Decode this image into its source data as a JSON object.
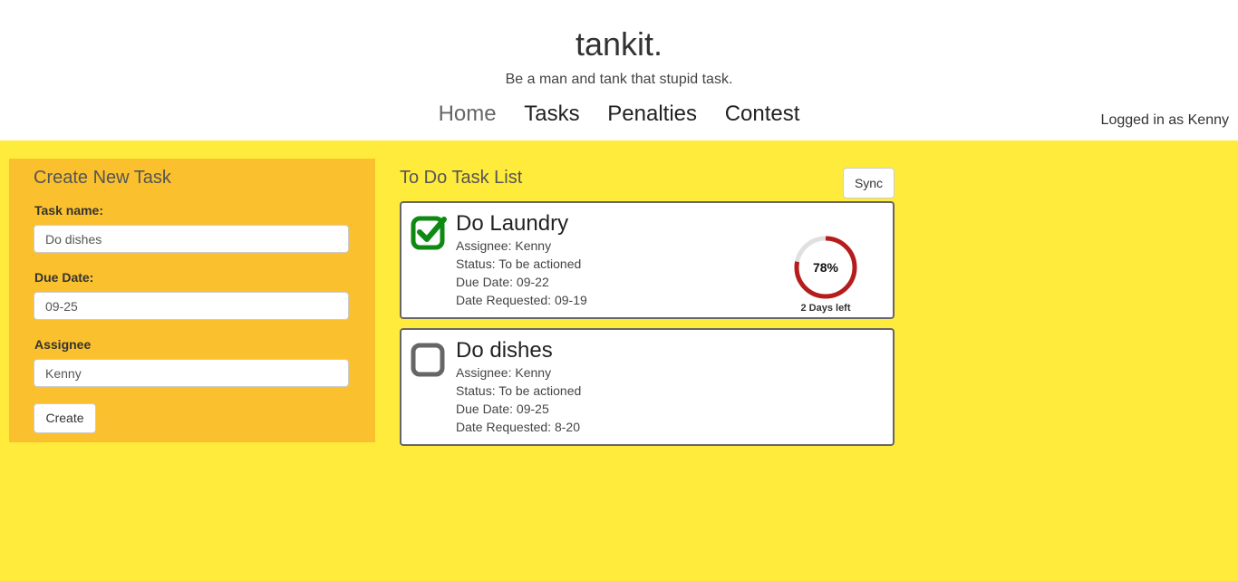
{
  "header": {
    "brand": "tankit.",
    "tagline": "Be a man and tank that stupid task.",
    "nav": [
      "Home",
      "Tasks",
      "Penalties",
      "Contest"
    ],
    "active_nav": "Home",
    "logged_in": "Logged in as Kenny"
  },
  "create": {
    "title": "Create New Task",
    "task_name_label": "Task name:",
    "task_name_value": "Do dishes",
    "due_date_label": "Due Date:",
    "due_date_value": "09-25",
    "assignee_label": "Assignee",
    "assignee_value": "Kenny",
    "create_button": "Create"
  },
  "list": {
    "title": "To Do Task List",
    "sync_button": "Sync",
    "tasks": [
      {
        "name": "Do Laundry",
        "checked": true,
        "assignee": "Assignee: Kenny",
        "status": "Status: To be actioned",
        "due": "Due Date: 09-22",
        "requested": "Date Requested: 09-19",
        "progress_label": "78%",
        "progress": 0.78,
        "days_left": "2 Days left"
      },
      {
        "name": "Do dishes",
        "checked": false,
        "assignee": "Assignee: Kenny",
        "status": "Status: To be actioned",
        "due": "Due Date: 09-25",
        "requested": "Date Requested: 8-20"
      }
    ]
  },
  "colors": {
    "background": "#ffeb3b",
    "panel": "#fbc02d",
    "check_green": "#0e8a12",
    "progress_red": "#b71c1c",
    "progress_track": "#e0e0e0",
    "unchecked_gray": "#666666"
  }
}
